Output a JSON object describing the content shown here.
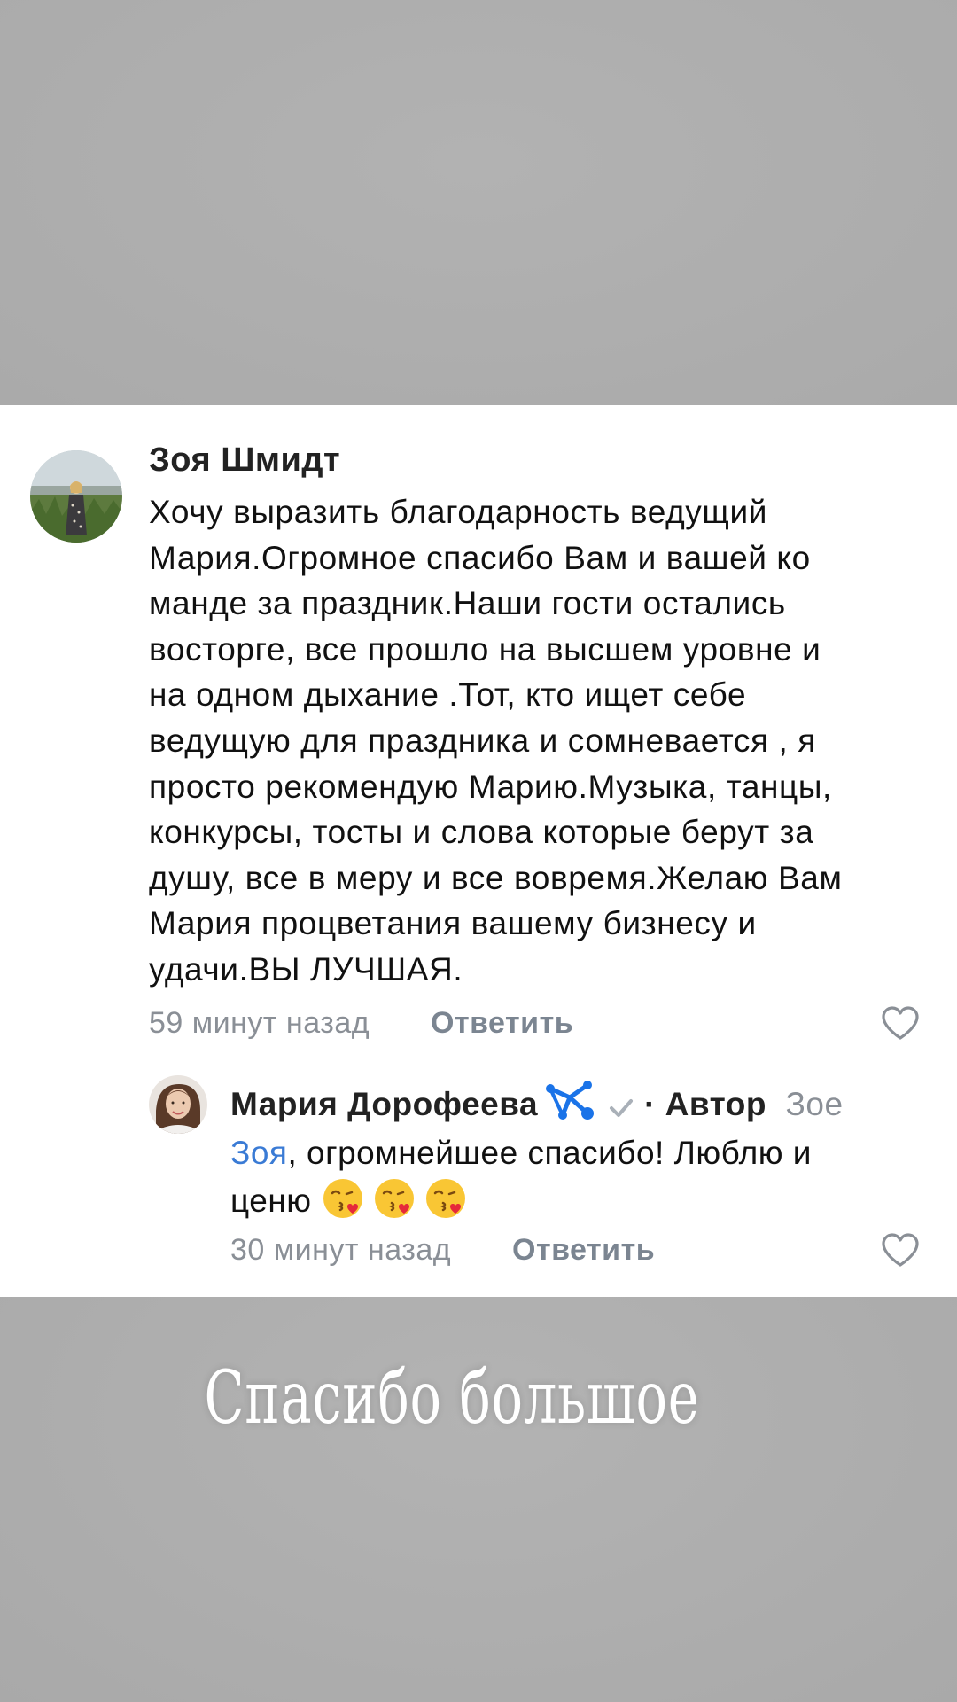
{
  "comment": {
    "author": "Зоя Шмидт",
    "text_lines": [
      "Хочу выразить благодарность ведущий",
      "Мария.Огромное спасибо Вам и вашей ко",
      "манде за праздник.Наши гости остались",
      "восторге, все прошло на высшем уровне и",
      "на одном дыхание .Тот, кто ищет себе",
      "ведущую для праздника и сомневается , я",
      "просто рекомендую Марию.Музыка, танцы,",
      "конкурсы, тосты и слова которые берут за",
      "душу, все в меру и все вовремя.Желаю Вам",
      "Мария процветания вашему бизнесу и",
      "удачи.ВЫ ЛУЧШАЯ."
    ],
    "time": "59 минут назад",
    "reply_label": "Ответить",
    "like_icon": "heart-outline-icon"
  },
  "reply": {
    "author": "Мария Дорофеева",
    "badge_icon": "blue-network-badge-icon",
    "verified_icon": "checkmark-icon",
    "author_tag": "· Автор",
    "mention_part1": "Зое",
    "mention_part2": "Зоя",
    "text_after_mention": ", огромнейшее спасибо! Люблю и",
    "text_line2": "ценю",
    "emoji": [
      "kissing-heart-emoji",
      "kissing-heart-emoji",
      "kissing-heart-emoji"
    ],
    "time": "30 минут назад",
    "reply_label": "Ответить",
    "like_icon": "heart-outline-icon"
  },
  "overlay_caption": "Спасибо большое",
  "colors": {
    "link_blue": "#3a7bd5",
    "meta_gray": "#8a8f96",
    "badge_blue": "#1a73e8"
  }
}
